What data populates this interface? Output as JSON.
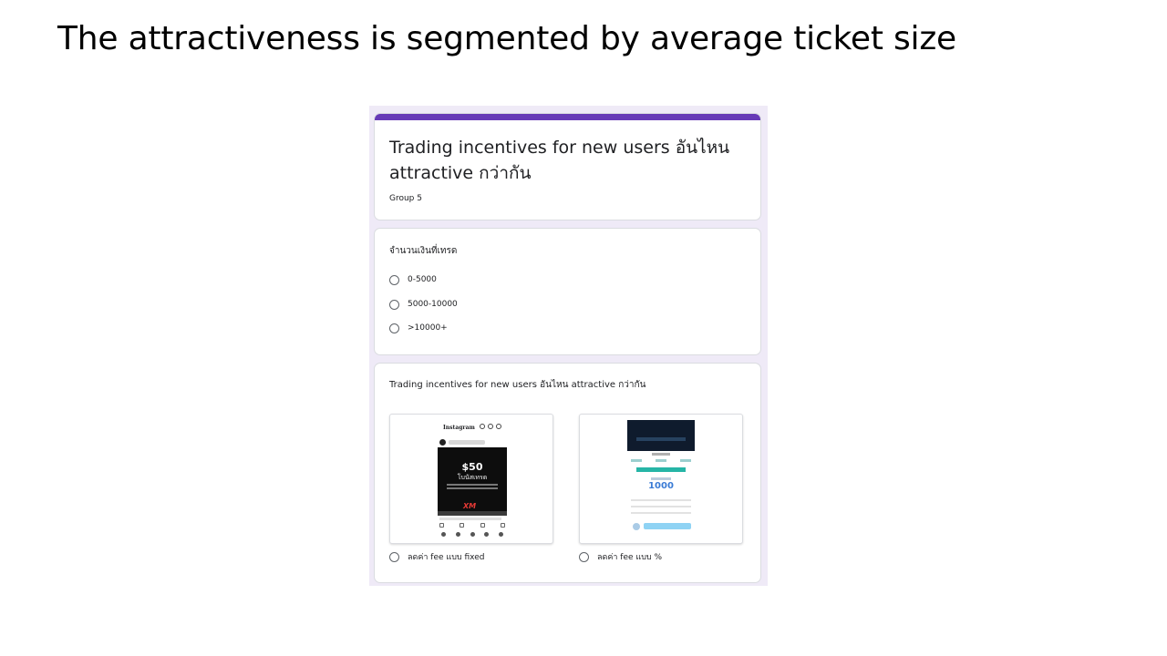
{
  "slide": {
    "title": "The attractiveness is segmented by average ticket size"
  },
  "form": {
    "accent_color": "#673ab7",
    "title": "Trading incentives for new users อันไหน attractive กว่ากัน",
    "subtitle": "Group 5",
    "question1": {
      "title": "จำนวนเงินที่เทรด",
      "options": [
        "0-5000",
        "5000-10000",
        ">10000+"
      ]
    },
    "question2": {
      "title": "Trading incentives for new users อันไหน attractive กว่ากัน",
      "options": [
        {
          "label": "ลดค่า fee แบบ fixed",
          "image": {
            "type": "social-post-screenshot",
            "promo_amount": "$50",
            "promo_text": "โบนัสเทรด",
            "brand": "XM"
          }
        },
        {
          "label": "ลดค่า fee แบบ %",
          "image": {
            "type": "app-screenshot",
            "amount": "1000"
          }
        }
      ]
    }
  }
}
